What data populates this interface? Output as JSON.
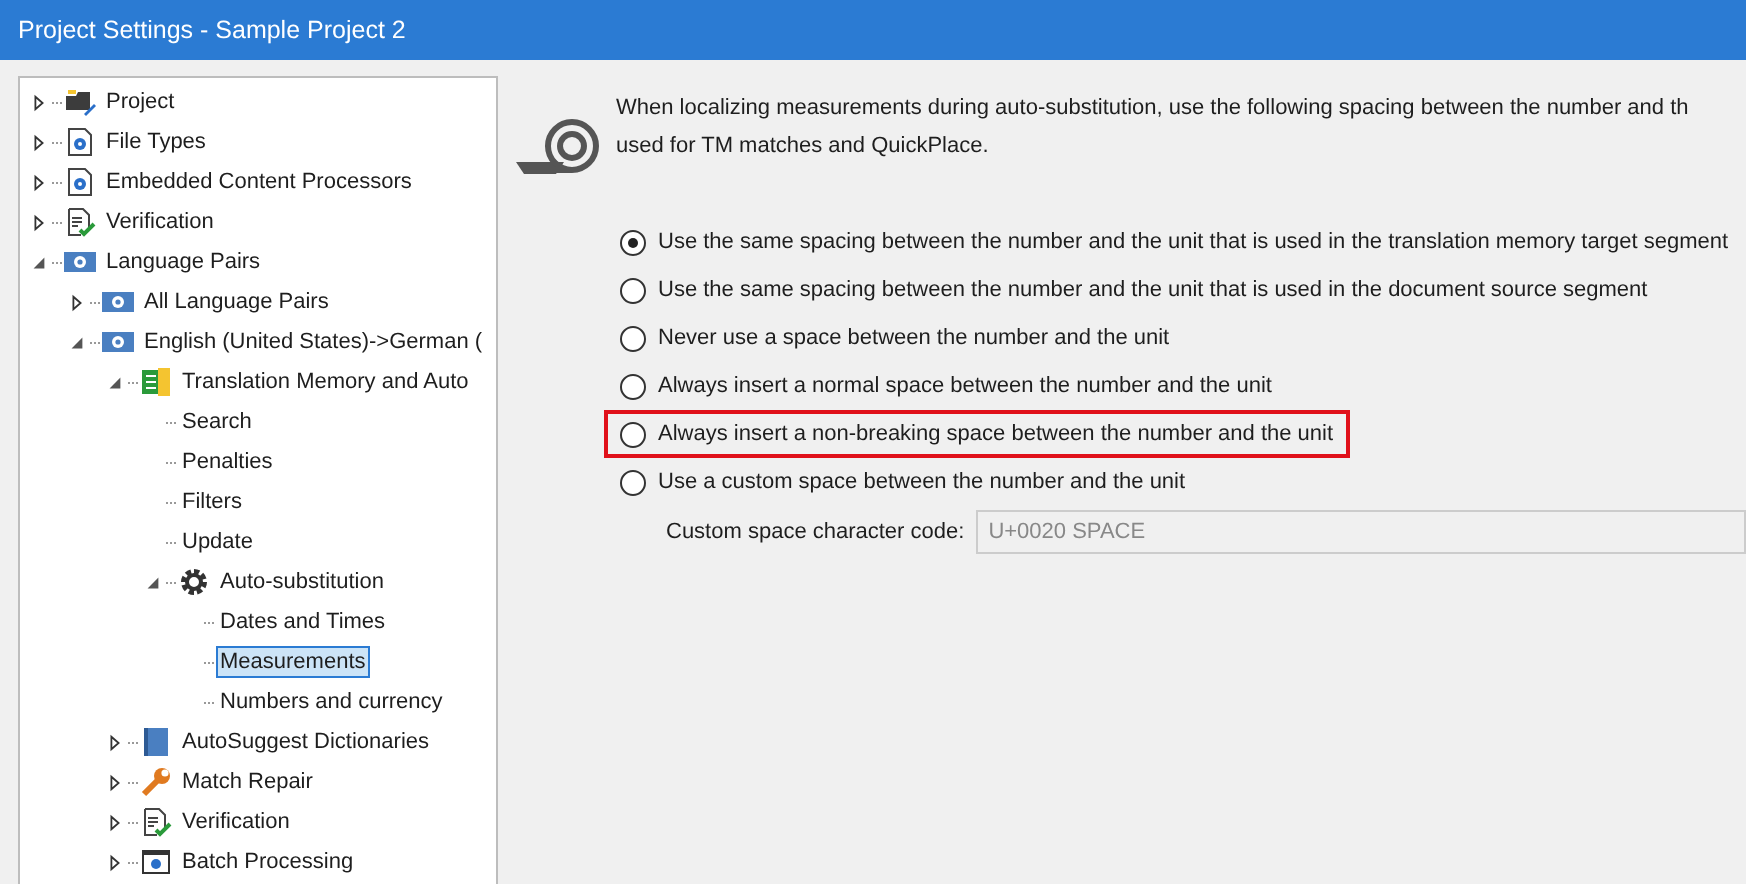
{
  "window": {
    "title": "Project Settings - Sample Project 2"
  },
  "tree": [
    {
      "label": "Project",
      "kind": "project",
      "expanded": false,
      "selected": false
    },
    {
      "label": "File Types",
      "kind": "gear-doc",
      "expanded": false,
      "selected": false
    },
    {
      "label": "Embedded Content Processors",
      "kind": "gear-doc",
      "expanded": false,
      "selected": false
    },
    {
      "label": "Verification",
      "kind": "check-doc",
      "expanded": false,
      "selected": false
    },
    {
      "label": "Language Pairs",
      "kind": "lang",
      "expanded": true,
      "selected": false,
      "children": [
        {
          "label": "All Language Pairs",
          "kind": "lang",
          "expanded": false,
          "selected": false
        },
        {
          "label": "English (United States)->German (",
          "kind": "lang",
          "expanded": true,
          "selected": false,
          "children": [
            {
              "label": "Translation Memory and Auto",
              "kind": "tm",
              "expanded": true,
              "selected": false,
              "children": [
                {
                  "label": "Search",
                  "selected": false
                },
                {
                  "label": "Penalties",
                  "selected": false
                },
                {
                  "label": "Filters",
                  "selected": false
                },
                {
                  "label": "Update",
                  "selected": false
                },
                {
                  "label": "Auto-substitution",
                  "kind": "gear",
                  "expanded": true,
                  "selected": false,
                  "children": [
                    {
                      "label": "Dates and Times",
                      "selected": false
                    },
                    {
                      "label": "Measurements",
                      "selected": true
                    },
                    {
                      "label": "Numbers and currency",
                      "selected": false
                    }
                  ]
                }
              ]
            },
            {
              "label": "AutoSuggest Dictionaries",
              "kind": "book",
              "expanded": false,
              "selected": false
            },
            {
              "label": "Match Repair",
              "kind": "wrench",
              "expanded": false,
              "selected": false
            },
            {
              "label": "Verification",
              "kind": "check-doc",
              "expanded": false,
              "selected": false
            },
            {
              "label": "Batch Processing",
              "kind": "batch",
              "expanded": false,
              "selected": false
            }
          ]
        }
      ]
    }
  ],
  "description": [
    "When localizing measurements during auto-substitution, use the following spacing between the number and th",
    "used for TM matches and QuickPlace."
  ],
  "options": [
    {
      "label": "Use the same spacing between the number and the unit that is used in the translation memory target segment",
      "selected": true,
      "highlighted": false
    },
    {
      "label": "Use the same spacing between the number and the unit that is used in the document source segment",
      "selected": false,
      "highlighted": false
    },
    {
      "label": "Never use a space between the number and the unit",
      "selected": false,
      "highlighted": false
    },
    {
      "label": "Always insert a normal space between the number and the unit",
      "selected": false,
      "highlighted": false
    },
    {
      "label": "Always insert a non-breaking space between the number and the unit",
      "selected": false,
      "highlighted": true
    },
    {
      "label": "Use a custom space between the number and the unit",
      "selected": false,
      "highlighted": false
    }
  ],
  "custom_field": {
    "label": "Custom space character code:",
    "value": "U+0020 SPACE",
    "disabled": true
  }
}
